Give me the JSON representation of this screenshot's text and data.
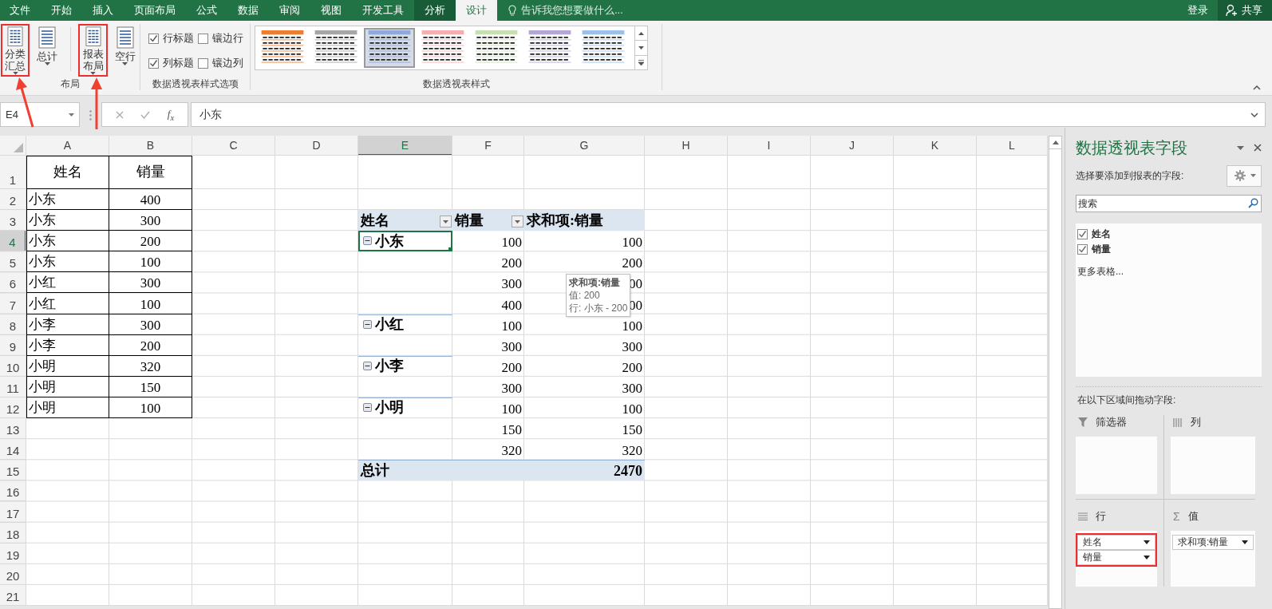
{
  "tabs": [
    {
      "label": "文件",
      "selected": false,
      "kind": "normal"
    },
    {
      "label": "开始",
      "selected": false,
      "kind": "normal"
    },
    {
      "label": "插入",
      "selected": false,
      "kind": "normal"
    },
    {
      "label": "页面布局",
      "selected": false,
      "kind": "normal"
    },
    {
      "label": "公式",
      "selected": false,
      "kind": "normal"
    },
    {
      "label": "数据",
      "selected": false,
      "kind": "normal"
    },
    {
      "label": "审阅",
      "selected": false,
      "kind": "normal"
    },
    {
      "label": "视图",
      "selected": false,
      "kind": "normal"
    },
    {
      "label": "开发工具",
      "selected": false,
      "kind": "normal"
    },
    {
      "label": "分析",
      "selected": false,
      "kind": "contextual"
    },
    {
      "label": "设计",
      "selected": true,
      "kind": "contextual"
    }
  ],
  "tell_me": {
    "text": "告诉我您想要做什么..."
  },
  "account": {
    "sign_in": "登录",
    "share": "共享"
  },
  "ribbon": {
    "layout_group": {
      "title": "布局",
      "buttons": [
        {
          "label": "分类汇总",
          "highlighted": true
        },
        {
          "label": "总计",
          "highlighted": false
        },
        {
          "label": "报表布局",
          "highlighted": true
        },
        {
          "label": "空行",
          "highlighted": false
        }
      ]
    },
    "style_options": {
      "title": "数据透视表样式选项",
      "checkboxes": [
        {
          "label": "行标题",
          "checked": true
        },
        {
          "label": "镶边行",
          "checked": false
        },
        {
          "label": "列标题",
          "checked": true
        },
        {
          "label": "镶边列",
          "checked": false
        }
      ]
    },
    "styles": {
      "title": "数据透视表样式",
      "items": [
        {
          "color": "#ed7d31",
          "selected": false
        },
        {
          "color": "#a6a6a6",
          "selected": false
        },
        {
          "color": "#8ea9db",
          "selected": true
        },
        {
          "color": "#f4b0b0",
          "selected": false
        },
        {
          "color": "#c6e0b4",
          "selected": false
        },
        {
          "color": "#b4a7d6",
          "selected": false
        },
        {
          "color": "#9bc2e6",
          "selected": false
        }
      ]
    }
  },
  "formula_bar": {
    "name_box": "E4",
    "function_label": "f$_{x}$",
    "value": "小东"
  },
  "sheet": {
    "columns": [
      {
        "label": "A",
        "selected": false
      },
      {
        "label": "B",
        "selected": false
      },
      {
        "label": "C",
        "selected": false
      },
      {
        "label": "D",
        "selected": false
      },
      {
        "label": "E",
        "selected": true
      },
      {
        "label": "F",
        "selected": false
      },
      {
        "label": "G",
        "selected": false
      },
      {
        "label": "H",
        "selected": false
      },
      {
        "label": "I",
        "selected": false
      },
      {
        "label": "J",
        "selected": false
      },
      {
        "label": "K",
        "selected": false
      },
      {
        "label": "L",
        "selected": false
      }
    ],
    "rows": [
      {
        "label": "1",
        "selected": false
      },
      {
        "label": "2",
        "selected": false
      },
      {
        "label": "3",
        "selected": false
      },
      {
        "label": "4",
        "selected": true
      },
      {
        "label": "5",
        "selected": false
      },
      {
        "label": "6",
        "selected": false
      },
      {
        "label": "7",
        "selected": false
      },
      {
        "label": "8",
        "selected": false
      },
      {
        "label": "9",
        "selected": false
      },
      {
        "label": "10",
        "selected": false
      },
      {
        "label": "11",
        "selected": false
      },
      {
        "label": "12",
        "selected": false
      },
      {
        "label": "13",
        "selected": false
      },
      {
        "label": "14",
        "selected": false
      },
      {
        "label": "15",
        "selected": false
      },
      {
        "label": "16",
        "selected": false
      },
      {
        "label": "17",
        "selected": false
      },
      {
        "label": "18",
        "selected": false
      },
      {
        "label": "19",
        "selected": false
      },
      {
        "label": "20",
        "selected": false
      },
      {
        "label": "21",
        "selected": false
      }
    ],
    "source_table": {
      "header": [
        "姓名",
        "销量"
      ],
      "rows": [
        [
          "小东",
          "400"
        ],
        [
          "小东",
          "300"
        ],
        [
          "小东",
          "200"
        ],
        [
          "小东",
          "100"
        ],
        [
          "小红",
          "300"
        ],
        [
          "小红",
          "100"
        ],
        [
          "小李",
          "300"
        ],
        [
          "小李",
          "200"
        ],
        [
          "小明",
          "320"
        ],
        [
          "小明",
          "150"
        ],
        [
          "小明",
          "100"
        ]
      ]
    },
    "pivot": {
      "header": {
        "rows_label": "姓名",
        "field_label": "销量",
        "values_label": "求和项:销量"
      },
      "rows": [
        {
          "name": "小东",
          "qty": "100",
          "sum": "100",
          "selected": true
        },
        {
          "qty": "200",
          "sum": "200",
          "selected": false
        },
        {
          "qty": "300",
          "sum": "00",
          "selected": false
        },
        {
          "qty": "400",
          "sum": "00",
          "selected": false
        },
        {
          "name": "小红",
          "qty": "100",
          "sum": "100",
          "selected": false
        },
        {
          "qty": "300",
          "sum": "300",
          "selected": false
        },
        {
          "name": "小李",
          "qty": "200",
          "sum": "200",
          "selected": false
        },
        {
          "qty": "300",
          "sum": "300",
          "selected": false
        },
        {
          "name": "小明",
          "qty": "100",
          "sum": "100",
          "selected": false
        },
        {
          "qty": "150",
          "sum": "150",
          "selected": false
        },
        {
          "qty": "320",
          "sum": "320",
          "selected": false
        }
      ],
      "total": {
        "label": "总计",
        "sum": "2470"
      }
    },
    "tooltip": {
      "title": "求和项:销量",
      "lines": [
        "值: 200",
        "行: 小东 - 200"
      ]
    }
  },
  "pane": {
    "title": "数据透视表字段",
    "prompt": "选择要添加到报表的字段:",
    "search": {
      "placeholder": "搜索"
    },
    "fields": [
      {
        "label": "姓名",
        "checked": true
      },
      {
        "label": "销量",
        "checked": true
      }
    ],
    "more_tables": "更多表格...",
    "drag_prompt": "在以下区域间拖动字段:",
    "areas": [
      {
        "kind": "filter",
        "label": "筛选器"
      },
      {
        "kind": "columns",
        "label": "列"
      },
      {
        "kind": "rows",
        "label": "行",
        "highlighted": true,
        "items": [
          "姓名",
          "销量"
        ]
      },
      {
        "kind": "values",
        "label": "值",
        "icon": "Σ",
        "highlighted": false,
        "items": [
          "求和项:销量"
        ]
      }
    ]
  }
}
